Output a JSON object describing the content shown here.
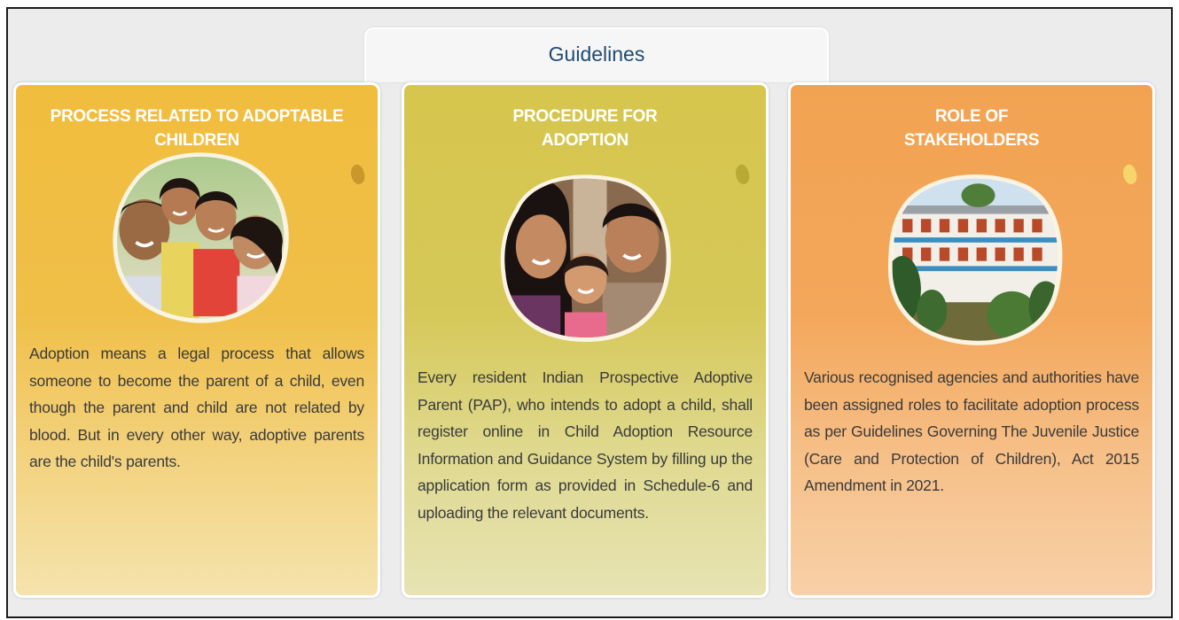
{
  "section": {
    "tab_label": "Guidelines"
  },
  "cards": [
    {
      "title_line1": "PROCESS RELATED TO ADOPTABLE CHILDREN",
      "title_line2": "",
      "image_icon": "family-photo",
      "description": "Adoption means a legal process that allows someone to become the parent of a child, even though the parent and child are not related by blood. But in every other way, adoptive parents are the child's parents.",
      "bg_color": "#f1bd3d"
    },
    {
      "title_line1": "PROCEDURE FOR",
      "title_line2": "ADOPTION",
      "image_icon": "parents-with-girl-photo",
      "description": "Every resident Indian Prospective Adoptive Parent (PAP), who intends to adopt a child, shall register online in Child Adoption Resource Information and Guidance System by filling up the application form as provided in Schedule-6 and uploading the relevant documents.",
      "bg_color": "#d6c64d"
    },
    {
      "title_line1": "ROLE OF",
      "title_line2": "STAKEHOLDERS",
      "image_icon": "building-photo",
      "description": "Various recognised agencies and authorities have been assigned roles to facilitate adoption process as per Guidelines Governing The Juvenile Justice (Care and Protection of Children), Act 2015 Amendment in 2021.",
      "bg_color": "#f2a352"
    }
  ]
}
